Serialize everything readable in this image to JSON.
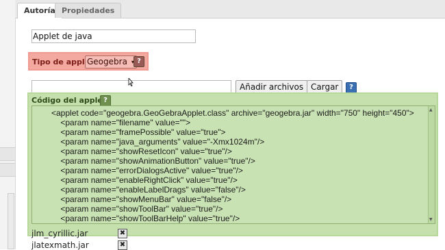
{
  "tabs": [
    {
      "label": "Autoría",
      "active": true
    },
    {
      "label": "Propiedades",
      "active": false
    }
  ],
  "title_input": {
    "value": "Applet de java"
  },
  "applet_type": {
    "label": "Tipo de applet",
    "selected": "Geogebra",
    "help_icon": "?"
  },
  "upload": {
    "add_label": "Añadir archivos",
    "load_label": "Cargar",
    "help_icon": "?"
  },
  "code": {
    "label": "Código del applet:",
    "help_icon": "?",
    "lines": [
      "<applet code=\"geogebra.GeoGebraApplet.class\" archive=\"geogebra.jar\" width=\"750\" height=\"450\">",
      "    <param name=\"filename\" value=\"\">",
      "    <param name=\"framePossible\" value=\"true\">",
      "    <param name=\"java_arguments\" value=\"-Xmx1024m\"/>",
      "    <param name=\"showResetIcon\" value=\"true\"/>",
      "    <param name=\"showAnimationButton\" value=\"true\"/>",
      "    <param name=\"errorDialogsActive\" value=\"true\"/>",
      "    <param name=\"enableRightClick\" value=\"true\"/>",
      "    <param name=\"enableLabelDrags\" value=\"false\"/>",
      "    <param name=\"showMenuBar\" value=\"false\"/>",
      "    <param name=\"showToolBar\" value=\"true\"/>",
      "    <param name=\"showToolBarHelp\" value=\"true\"/>"
    ]
  },
  "files": [
    {
      "name": "jlm_cyrillic.jar",
      "delete_icon": "✖"
    },
    {
      "name": "jlatexmath.jar",
      "delete_icon": "✖"
    }
  ],
  "colors": {
    "type_box": "#f3a8a0",
    "code_panel": "#c5e0ad"
  }
}
